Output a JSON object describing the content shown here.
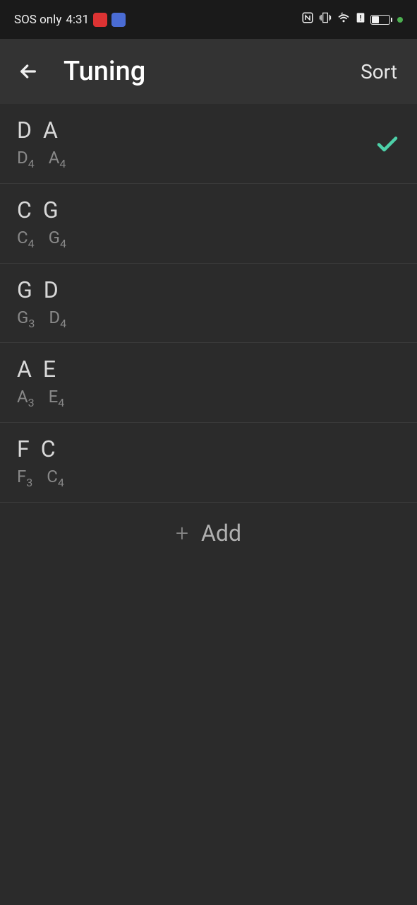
{
  "status_bar": {
    "network_text": "SOS only",
    "time": "4:31"
  },
  "app_bar": {
    "title": "Tuning",
    "sort_label": "Sort"
  },
  "tunings": [
    {
      "note1": "D",
      "note2": "A",
      "detail1_note": "D",
      "detail1_octave": "4",
      "detail2_note": "A",
      "detail2_octave": "4",
      "selected": true
    },
    {
      "note1": "C",
      "note2": "G",
      "detail1_note": "C",
      "detail1_octave": "4",
      "detail2_note": "G",
      "detail2_octave": "4",
      "selected": false
    },
    {
      "note1": "G",
      "note2": "D",
      "detail1_note": "G",
      "detail1_octave": "3",
      "detail2_note": "D",
      "detail2_octave": "4",
      "selected": false
    },
    {
      "note1": "A",
      "note2": "E",
      "detail1_note": "A",
      "detail1_octave": "3",
      "detail2_note": "E",
      "detail2_octave": "4",
      "selected": false
    },
    {
      "note1": "F",
      "note2": "C",
      "detail1_note": "F",
      "detail1_octave": "3",
      "detail2_note": "C",
      "detail2_octave": "4",
      "selected": false
    }
  ],
  "add_button": {
    "label": "Add"
  }
}
